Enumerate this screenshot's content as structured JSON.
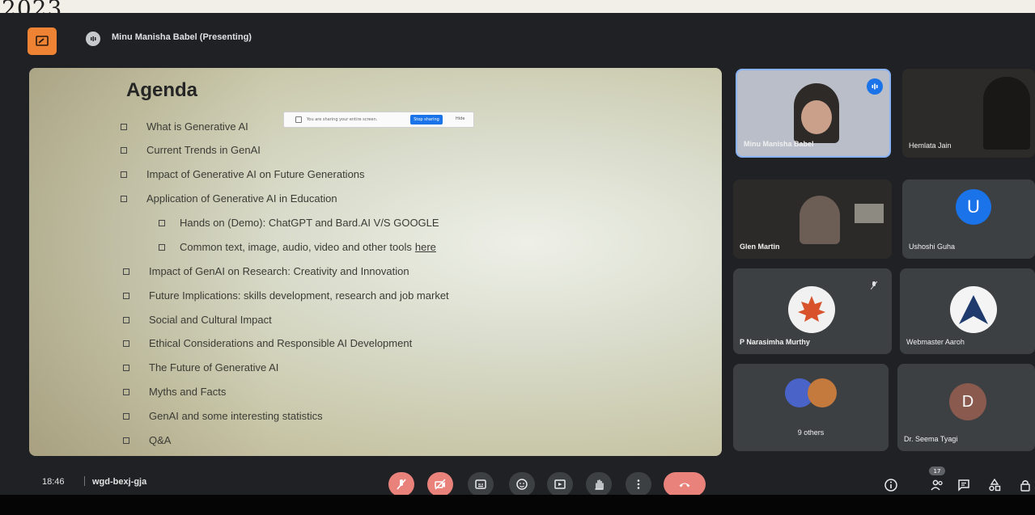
{
  "photo": {
    "stamp": "2023 ."
  },
  "header": {
    "presenter": "Minu Manisha Babel (Presenting)"
  },
  "share_notice": {
    "text": "You are sharing your entire screen.",
    "stop_label": "Stop sharing",
    "hide_label": "Hide"
  },
  "slide": {
    "title": "Agenda",
    "items": [
      {
        "text": "What is Generative AI"
      },
      {
        "text": "Current Trends in GenAI"
      },
      {
        "text": "Impact of Generative AI on Future Generations"
      },
      {
        "text": "Application of Generative AI in Education"
      },
      {
        "text": "Hands on (Demo): ChatGPT and Bard.AI V/S GOOGLE"
      },
      {
        "text": "Common text, image, audio, video and other tools",
        "link": "here"
      },
      {
        "text": "Impact of GenAI on Research: Creativity and Innovation"
      },
      {
        "text": "Future Implications: skills development, research and job market"
      },
      {
        "text": "Social and Cultural Impact"
      },
      {
        "text": "Ethical Considerations and Responsible AI Development"
      },
      {
        "text": "The Future of Generative AI"
      },
      {
        "text": "Myths and Facts"
      },
      {
        "text": "GenAI and some interesting statistics"
      },
      {
        "text": "Q&A"
      }
    ]
  },
  "participants": [
    {
      "name": "Minu Manisha Babel"
    },
    {
      "name": "Hemlata Jain"
    },
    {
      "name": "Glen Martin"
    },
    {
      "name": "Ushoshi Guha",
      "initial": "U"
    },
    {
      "name": "P Narasimha Murthy"
    },
    {
      "name": "Webmaster Aaroh"
    },
    {
      "name": "9 others"
    },
    {
      "name": "Dr. Seema Tyagi",
      "initial": "D"
    }
  ],
  "footer": {
    "time": "18:46",
    "meeting_code": "wgd-bexj-gja",
    "badge": "17"
  },
  "colors": {
    "accent_orange": "#ee8433",
    "blue": "#1a73e8",
    "end_call": "#e8827a",
    "tile": "#3c4043"
  }
}
